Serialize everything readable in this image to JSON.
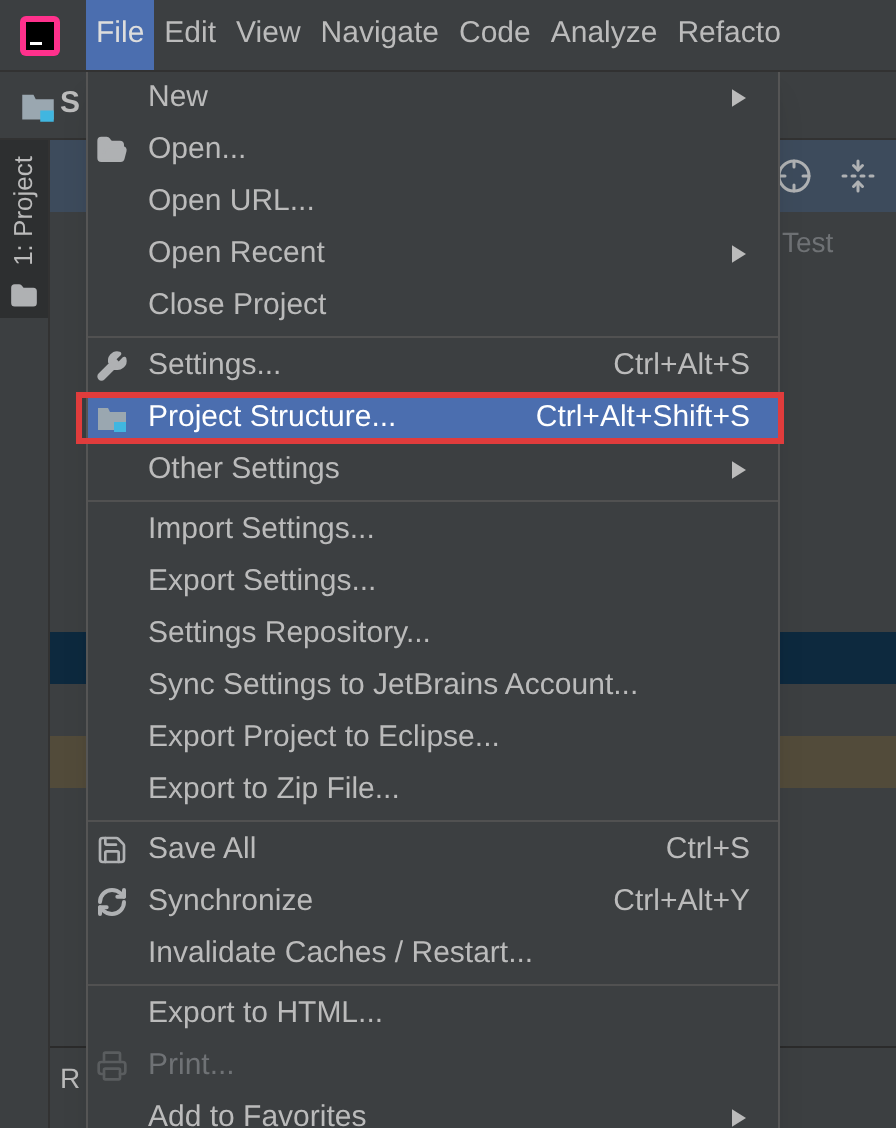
{
  "menubar": [
    {
      "label": "File",
      "selected": true
    },
    {
      "label": "Edit",
      "selected": false
    },
    {
      "label": "View",
      "selected": false
    },
    {
      "label": "Navigate",
      "selected": false
    },
    {
      "label": "Code",
      "selected": false
    },
    {
      "label": "Analyze",
      "selected": false
    },
    {
      "label": "Refacto",
      "selected": false
    }
  ],
  "toolbar": {
    "title": "S"
  },
  "tool_window_tab": {
    "label": "1: Project"
  },
  "tree": {
    "item": "Test"
  },
  "status": {
    "text": "R"
  },
  "file_menu": {
    "items": [
      {
        "kind": "item",
        "label": "New",
        "submenu": true
      },
      {
        "kind": "folder",
        "label": "Open..."
      },
      {
        "kind": "item",
        "label": "Open URL..."
      },
      {
        "kind": "item",
        "label": "Open Recent",
        "submenu": true
      },
      {
        "kind": "item",
        "label": "Close Project"
      },
      {
        "kind": "separator"
      },
      {
        "kind": "wrench",
        "label": "Settings...",
        "shortcut": "Ctrl+Alt+S"
      },
      {
        "kind": "project",
        "label": "Project Structure...",
        "shortcut": "Ctrl+Alt+Shift+S",
        "selected": true,
        "annotated": true
      },
      {
        "kind": "item",
        "label": "Other Settings",
        "submenu": true
      },
      {
        "kind": "separator"
      },
      {
        "kind": "item",
        "label": "Import Settings..."
      },
      {
        "kind": "item",
        "label": "Export Settings..."
      },
      {
        "kind": "item",
        "label": "Settings Repository..."
      },
      {
        "kind": "item",
        "label": "Sync Settings to JetBrains Account..."
      },
      {
        "kind": "item",
        "label": "Export Project to Eclipse..."
      },
      {
        "kind": "item",
        "label": "Export to Zip File..."
      },
      {
        "kind": "separator"
      },
      {
        "kind": "floppy",
        "label": "Save All",
        "shortcut": "Ctrl+S"
      },
      {
        "kind": "refresh",
        "label": "Synchronize",
        "shortcut": "Ctrl+Alt+Y"
      },
      {
        "kind": "item",
        "label": "Invalidate Caches / Restart..."
      },
      {
        "kind": "separator"
      },
      {
        "kind": "item",
        "label": "Export to HTML..."
      },
      {
        "kind": "printer",
        "label": "Print...",
        "disabled": true
      },
      {
        "kind": "item",
        "label": "Add to Favorites",
        "submenu": true
      }
    ]
  }
}
